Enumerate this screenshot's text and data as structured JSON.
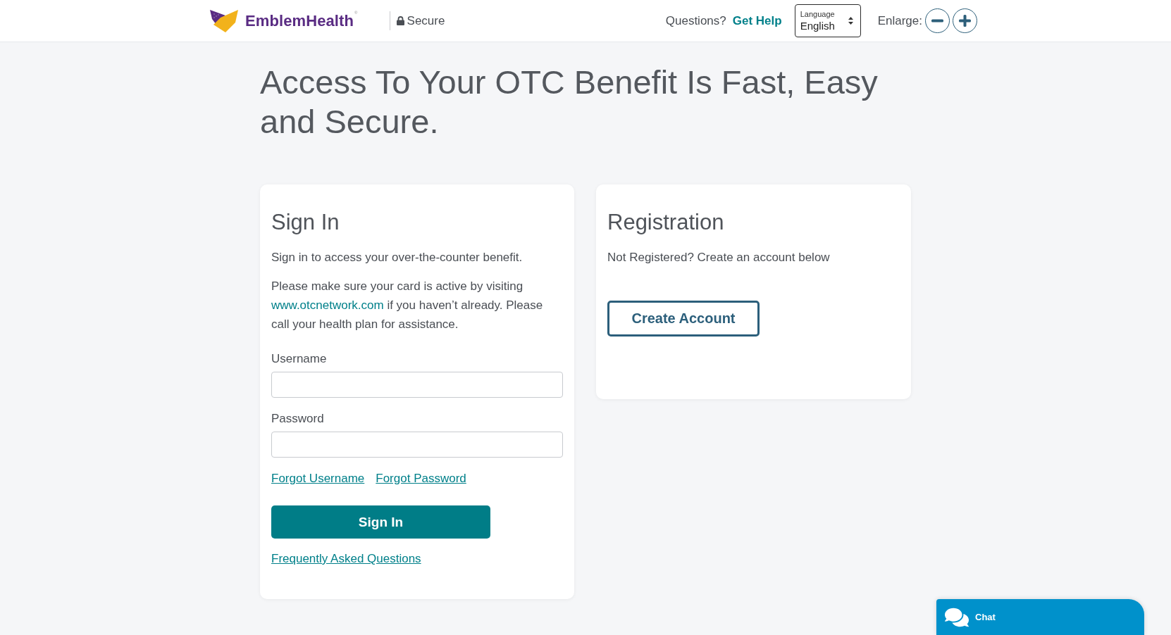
{
  "header": {
    "logo": {
      "text": "EmblemHealth$^{®}$"
    },
    "secure_label": "Secure",
    "help": {
      "prompt": "Questions?",
      "link": "Get Help"
    },
    "language_select": {
      "label": "Language",
      "value": "English"
    },
    "enlarge": {
      "label": "Enlarge:"
    }
  },
  "page_title": "Access To Your OTC Benefit Is Fast, Easy and Secure.",
  "sign_in_card": {
    "title": "Sign In",
    "intro": "Sign in to access your over-the-counter benefit.",
    "notice": {
      "before": "Please make sure your card is active by visiting ",
      "link": "www.otcnetwork.com",
      "after": " if you haven’t already. Please call your health plan for assistance."
    },
    "fields": [
      {
        "label": "Username"
      },
      {
        "label": "Password"
      }
    ],
    "links": [
      "Forgot Username",
      "Forgot Password"
    ],
    "submit_button": "Sign In",
    "faq_link": "Frequently Asked Questions"
  },
  "registration_card": {
    "title": "Registration",
    "text": "Not Registered? Create an account below",
    "button": "Create Account"
  },
  "chat_button": {
    "label": "Chat"
  }
}
